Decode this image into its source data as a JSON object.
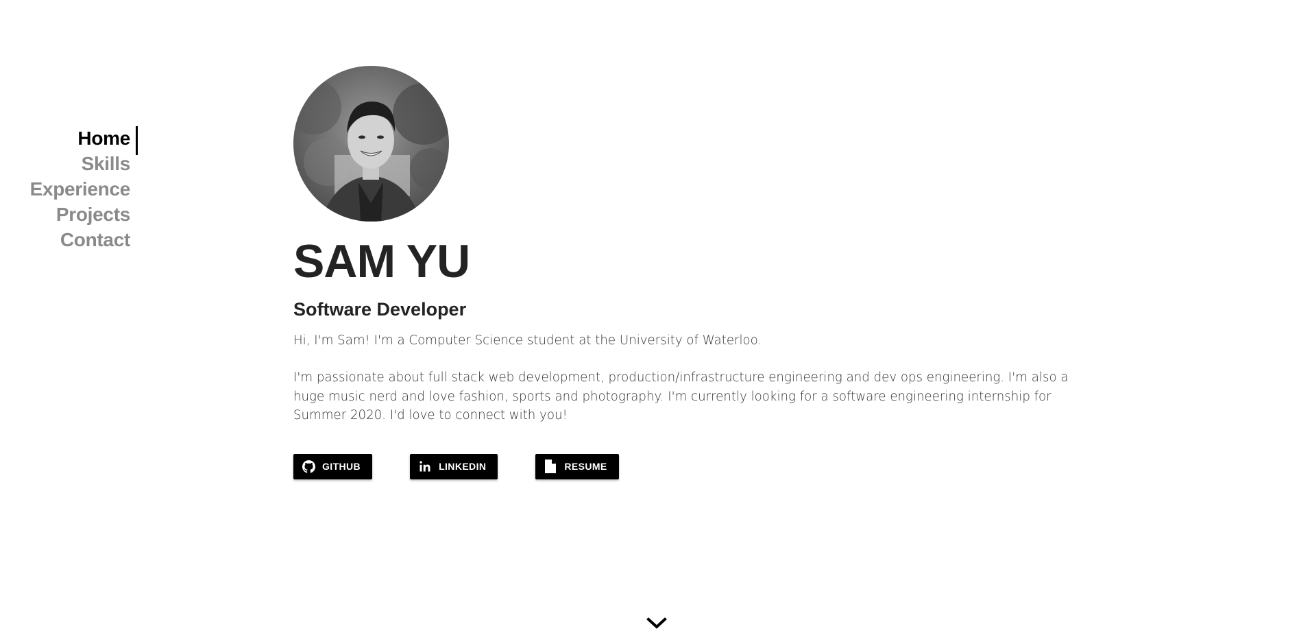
{
  "nav": {
    "items": [
      {
        "label": "Home",
        "active": true
      },
      {
        "label": "Skills",
        "active": false
      },
      {
        "label": "Experience",
        "active": false
      },
      {
        "label": "Projects",
        "active": false
      },
      {
        "label": "Contact",
        "active": false
      }
    ]
  },
  "profile": {
    "name": "SAM YU",
    "role": "Software Developer",
    "bio": [
      "Hi, I'm Sam! I'm a Computer Science student at the University of Waterloo.",
      "I'm passionate about full stack web development, production/infrastructure engineering and dev ops engineering. I'm also a huge music nerd and love fashion, sports and photography. I'm currently looking for a software engineering internship for Summer 2020. I'd love to connect with you!"
    ]
  },
  "buttons": [
    {
      "label": "GITHUB",
      "icon": "github-icon"
    },
    {
      "label": "LINKEDIN",
      "icon": "linkedin-icon"
    },
    {
      "label": "RESUME",
      "icon": "document-icon"
    }
  ],
  "scroll_indicator": {
    "icon": "chevron-down-icon"
  },
  "colors": {
    "nav_active": "#000000",
    "nav_inactive": "#8a8a8a",
    "text": "#232323",
    "button_bg": "#000000",
    "button_text": "#ffffff"
  }
}
